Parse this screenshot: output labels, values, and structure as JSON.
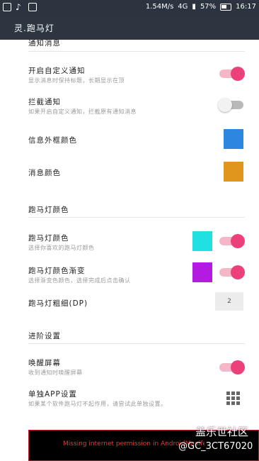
{
  "status_bar": {
    "speed": "1.54M/s",
    "network": "4G",
    "battery": "57%",
    "time": "16:17"
  },
  "app_bar": {
    "title": "灵.跑马灯"
  },
  "sections": {
    "notification": {
      "title": "通知消息",
      "rows": {
        "custom_notification": {
          "title": "开启自定义通知",
          "subtitle": "显示消息时保持标题，长期显示在顶",
          "state": "on"
        },
        "block_notification": {
          "title": "拦截通知",
          "subtitle": "如果开启自定义通知，拦截原有通知消息",
          "state": "off"
        },
        "info_border_color": {
          "title": "信息外框颜色",
          "color": "#2d87e0"
        },
        "message_color": {
          "title": "消息颜色",
          "color": "#e0961c"
        }
      }
    },
    "marquee": {
      "title": "跑马灯颜色",
      "rows": {
        "marquee_color": {
          "title": "跑马灯颜色",
          "subtitle": "选择你喜欢的跑马灯颜色",
          "color": "#21e0e2",
          "state": "on"
        },
        "marquee_gradient": {
          "title": "跑马灯颜色渐变",
          "subtitle": "选择渐变色颜色，选择完成后点击确认",
          "color": "#b31be0",
          "state": "on"
        },
        "marquee_width": {
          "title": "跑马灯粗细(DP)",
          "value": "2"
        }
      }
    },
    "advanced": {
      "title": "进阶设置",
      "rows": {
        "wake_screen": {
          "title": "唤醒屏幕",
          "subtitle": "收到通知时唤醒屏幕",
          "state": "on"
        },
        "per_app": {
          "title": "单独APP设置",
          "subtitle": "如果某个软件跑马灯不起作用，请尝试此单独设置。"
        }
      }
    }
  },
  "toast": {
    "message": "Missing internet permission in AndroidManife"
  },
  "watermark": {
    "line1": "盖乐世社区",
    "line2": "@GC_3CT67020"
  }
}
